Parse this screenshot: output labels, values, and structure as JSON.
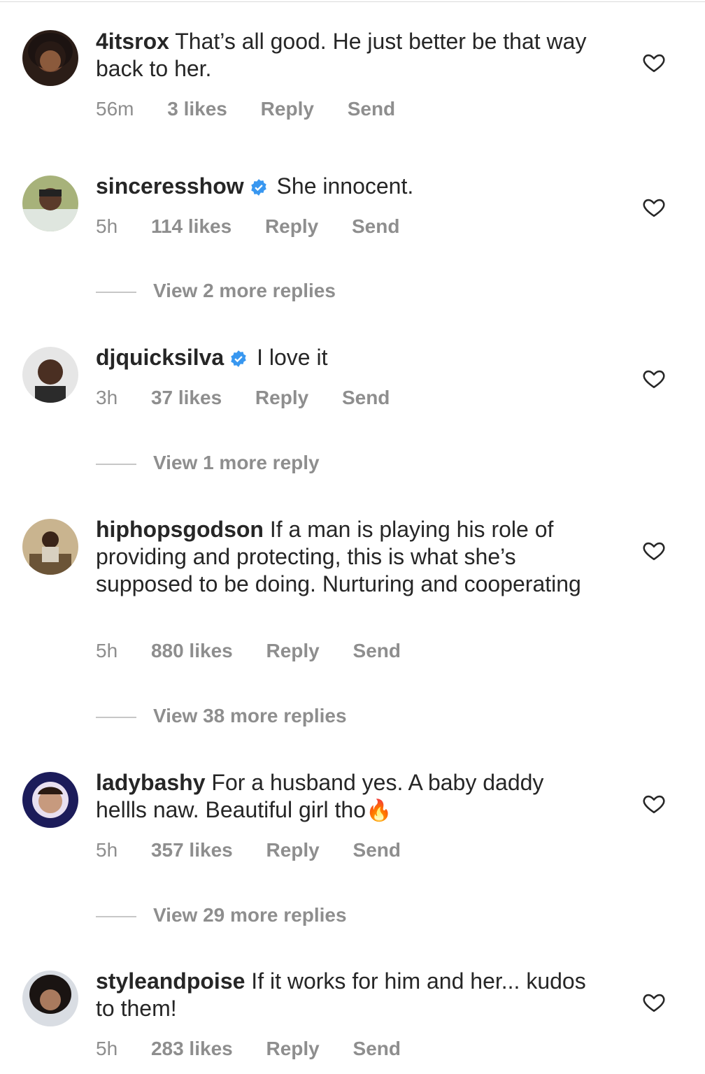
{
  "colors": {
    "muted": "#8e8e8e",
    "text": "#262626",
    "verified": "#3897f0"
  },
  "comments": [
    {
      "username": "4itsrox",
      "text": "That’s all good. He just better be that way back to her.",
      "time": "56m",
      "likes": "3 likes",
      "reply": "Reply",
      "send": "Send",
      "verified": false
    },
    {
      "username": "sinceresshow",
      "text": "She innocent.",
      "time": "5h",
      "likes": "114 likes",
      "reply": "Reply",
      "send": "Send",
      "verified": true,
      "view_replies": "View 2 more replies"
    },
    {
      "username": "djquicksilva",
      "text": "I love it",
      "time": "3h",
      "likes": "37 likes",
      "reply": "Reply",
      "send": "Send",
      "verified": true,
      "view_replies": "View 1 more reply"
    },
    {
      "username": "hiphopsgodson",
      "text": "If a man is playing his role of providing and protecting, this is what she’s supposed to be doing. Nurturing and cooperating",
      "time": "5h",
      "likes": "880 likes",
      "reply": "Reply",
      "send": "Send",
      "verified": false,
      "view_replies": "View 38 more replies"
    },
    {
      "username": "ladybashy",
      "text": "For a husband yes. A baby daddy hellls naw. Beautiful girl tho",
      "emoji": "🔥",
      "time": "5h",
      "likes": "357 likes",
      "reply": "Reply",
      "send": "Send",
      "verified": false,
      "view_replies": "View 29 more replies"
    },
    {
      "username": "styleandpoise",
      "text": "If it works for him and her... kudos to them!",
      "time": "5h",
      "likes": "283 likes",
      "reply": "Reply",
      "send": "Send",
      "verified": false
    }
  ]
}
